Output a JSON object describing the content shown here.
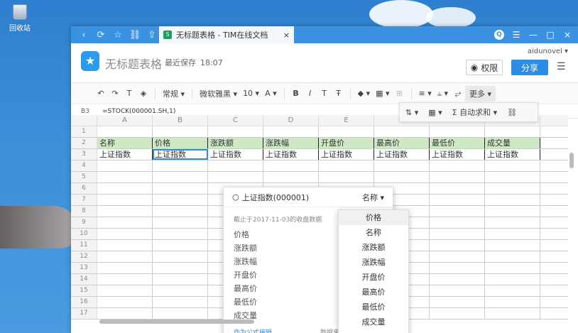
{
  "desktop": {
    "recycle_label": "回收站"
  },
  "window": {
    "nav": [
      "‹",
      "⟳",
      "☆",
      "⛓",
      "⇧"
    ],
    "tab": {
      "title": "无标题表格 - TIM在线文档",
      "close": "×"
    },
    "controls": {
      "q": "Q",
      "menu": "☰",
      "min": "—",
      "max": "□",
      "close": "×"
    }
  },
  "header": {
    "logo": "★",
    "title": "无标题表格",
    "save_label": "最近保存",
    "save_time": "18:07",
    "user": "aidunovel ▾",
    "perm": "权限",
    "share": "分享",
    "menu": "☰"
  },
  "toolbar": {
    "undo": "↶",
    "redo": "↷",
    "format_painter": "T",
    "clear": "◈",
    "number_format": "常规 ▾",
    "font": "微软雅黑 ▾",
    "font_size": "10 ▾",
    "font_color": "A ▾",
    "bold": "B",
    "italic": "I",
    "underline": "T",
    "strike": "Ŧ",
    "fill": "◆ ▾",
    "border": "▦ ▾",
    "merge": "⊞",
    "align": "≡ ▾",
    "valign": "⫨ ▾",
    "wrap": "⥂",
    "more": "更多 ▾"
  },
  "subtoolbar": {
    "sort": "⇅ ▾",
    "filter": "▦ ▾",
    "sum": "Σ 自动求和 ▾",
    "link": "⛓"
  },
  "formula_bar": {
    "ref": "B3",
    "formula": "=STOCK(000001.SH,1)"
  },
  "columns": [
    "A",
    "B",
    "C",
    "D",
    "E",
    "F",
    "G",
    "H"
  ],
  "rows": [
    {
      "n": "1",
      "cells": [
        "",
        "",
        "",
        "",
        "",
        "",
        "",
        ""
      ]
    },
    {
      "n": "2",
      "cells": [
        "名称",
        "价格",
        "涨跌额",
        "涨跌幅",
        "开盘价",
        "最高价",
        "最低价",
        "成交量"
      ]
    },
    {
      "n": "3",
      "cells": [
        "上证指数",
        "上证指数",
        "上证指数",
        "上证指数",
        "上证指数",
        "上证指数",
        "上证指数",
        "上证指数"
      ]
    },
    {
      "n": "4",
      "cells": [
        "",
        "",
        "",
        "",
        "",
        "",
        "",
        ""
      ]
    },
    {
      "n": "5",
      "cells": [
        "",
        "",
        "",
        "",
        "",
        "",
        "",
        ""
      ]
    },
    {
      "n": "6",
      "cells": [
        "",
        "",
        "",
        "",
        "",
        "",
        "",
        ""
      ]
    },
    {
      "n": "7",
      "cells": [
        "",
        "",
        "",
        "",
        "",
        "",
        "",
        ""
      ]
    },
    {
      "n": "8",
      "cells": [
        "",
        "",
        "",
        "",
        "",
        "",
        "",
        ""
      ]
    },
    {
      "n": "9",
      "cells": [
        "",
        "",
        "",
        "",
        "",
        "",
        "",
        ""
      ]
    },
    {
      "n": "10",
      "cells": [
        "",
        "",
        "",
        "",
        "",
        "",
        "",
        ""
      ]
    },
    {
      "n": "11",
      "cells": [
        "",
        "",
        "",
        "",
        "",
        "",
        "",
        ""
      ]
    },
    {
      "n": "12",
      "cells": [
        "",
        "",
        "",
        "",
        "",
        "",
        "",
        ""
      ]
    },
    {
      "n": "13",
      "cells": [
        "",
        "",
        "",
        "",
        "",
        "",
        "",
        ""
      ]
    },
    {
      "n": "14",
      "cells": [
        "",
        "",
        "",
        "",
        "",
        "",
        "",
        ""
      ]
    },
    {
      "n": "15",
      "cells": [
        "",
        "",
        "",
        "",
        "",
        "",
        "",
        ""
      ]
    },
    {
      "n": "16",
      "cells": [
        "",
        "",
        "",
        "",
        "",
        "",
        "",
        ""
      ]
    },
    {
      "n": "17",
      "cells": [
        "",
        "",
        "",
        "",
        "",
        "",
        "",
        ""
      ]
    }
  ],
  "popup": {
    "search_icon": "○",
    "search_text": "上证指数(000001)",
    "field_label": "名称 ▾",
    "note": "截止于2017-11-03的收盘数据",
    "fields": [
      "价格",
      "涨跌额",
      "涨跌幅",
      "开盘价",
      "最高价",
      "最低价",
      "成交量"
    ],
    "edit_link": "作为公式编辑",
    "data_source": "数据来"
  },
  "dropdown": [
    "价格",
    "名称",
    "涨跌额",
    "涨跌幅",
    "开盘价",
    "最高价",
    "最低价",
    "成交量"
  ]
}
